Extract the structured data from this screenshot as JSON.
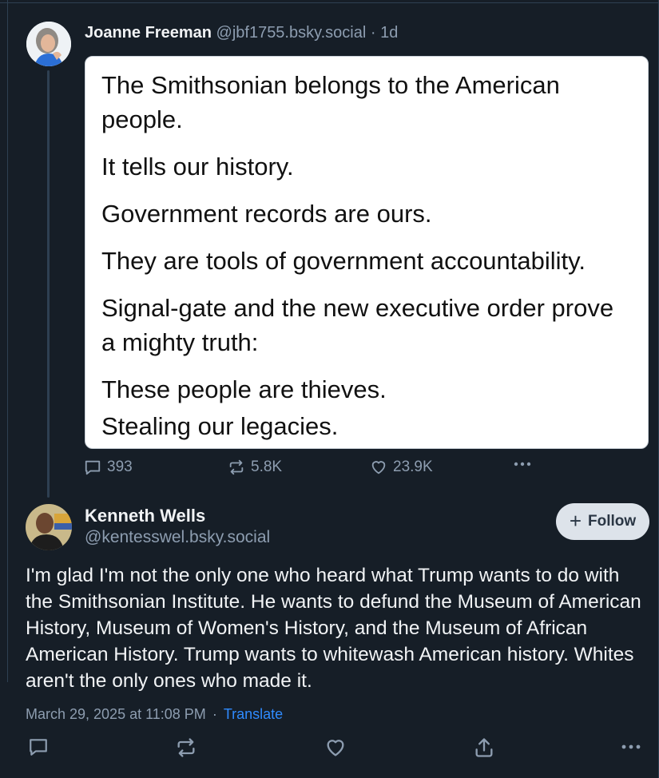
{
  "parent_post": {
    "author_name": "Joanne Freeman",
    "author_handle": "@jbf1755.bsky.social",
    "age": "· 1d",
    "quote_text": {
      "p1": "The Smithsonian belongs to the American people.",
      "p2": "It tells our history.",
      "p3": "Government records are ours.",
      "p4": "They are tools of government accountability.",
      "p5": "Signal-gate and the new executive order prove a mighty truth:",
      "p6": "These people are thieves.",
      "p7": "Stealing our legacies."
    },
    "metrics": {
      "replies": "393",
      "reposts": "5.8K",
      "likes": "23.9K"
    }
  },
  "main_post": {
    "author_name": "Kenneth Wells",
    "author_handle": "@kentesswel.bsky.social",
    "follow_label": "Follow",
    "follow_plus": "+",
    "body": "I'm glad I'm not the only one who heard what Trump wants to do with the Smithsonian Institute. He wants to defund the Museum of American History, Museum of Women's History, and the Museum of African American History. Trump wants to whitewash American history. Whites aren't the only ones who made it.",
    "timestamp": "March 29, 2025 at 11:08 PM",
    "separator": "·",
    "translate_label": "Translate"
  },
  "icons": {
    "reply": "reply-icon",
    "repost": "repost-icon",
    "like": "heart-icon",
    "share": "share-icon",
    "more": "more-icon"
  },
  "colors": {
    "background": "#161e27",
    "text_primary": "#f1f3f5",
    "text_secondary": "#8d9db0",
    "link": "#2f8bff",
    "follow_bg": "#dde3ea"
  }
}
